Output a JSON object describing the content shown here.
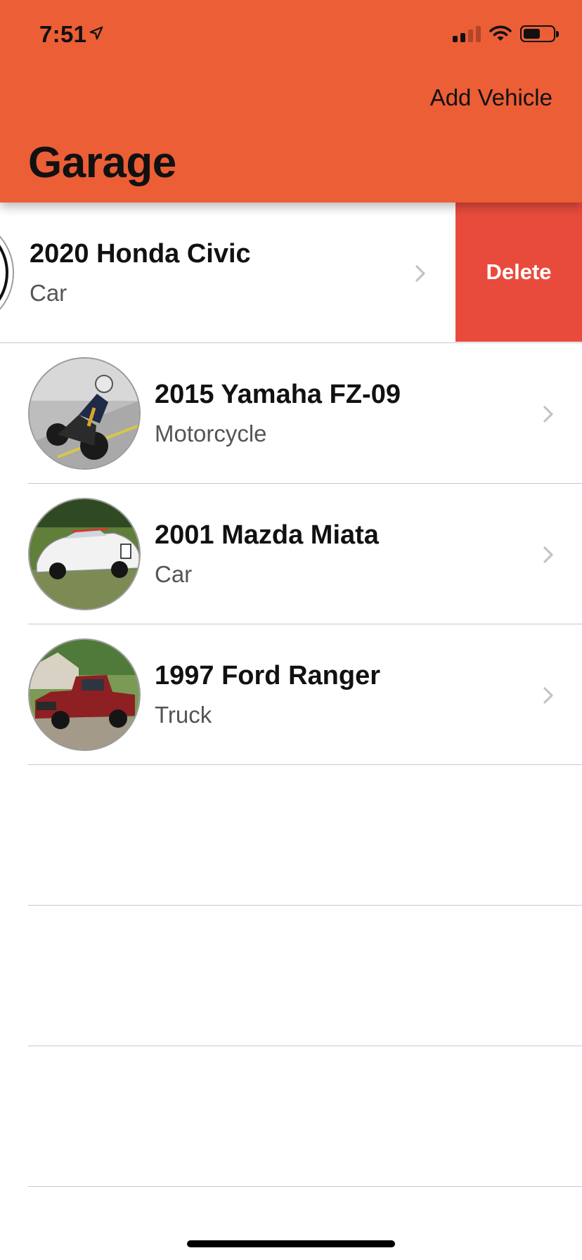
{
  "status_bar": {
    "time": "7:51",
    "location_icon": "location-arrow-icon",
    "signal_icon": "cellular-signal-icon",
    "wifi_icon": "wifi-icon",
    "battery_icon": "battery-icon",
    "battery_level": 0.5
  },
  "header": {
    "title": "Garage",
    "add_label": "Add Vehicle",
    "color": "#EC5E36"
  },
  "vehicles": [
    {
      "title": "2020 Honda Civic",
      "type": "Car",
      "swiped": true
    },
    {
      "title": "2015 Yamaha FZ-09",
      "type": "Motorcycle"
    },
    {
      "title": "2001 Mazda Miata",
      "type": "Car"
    },
    {
      "title": "1997 Ford Ranger",
      "type": "Truck"
    }
  ],
  "row_actions": {
    "delete_label": "Delete",
    "delete_color": "#E84B3C"
  },
  "chevron_icon": "chevron-right-icon"
}
